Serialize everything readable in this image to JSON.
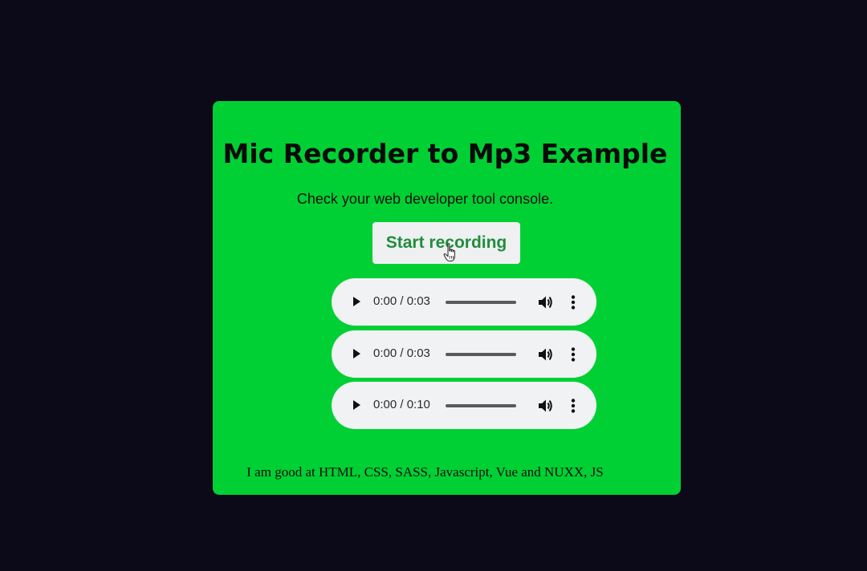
{
  "page": {
    "title": "Mic Recorder to Mp3 Example",
    "subtitle": "Check your web developer tool console.",
    "record_button_label": "Start recording",
    "footer": "I am good at HTML, CSS, SASS, Javascript, Vue and NUXX, JS"
  },
  "players": [
    {
      "time": "0:00 / 0:03",
      "progress": 0
    },
    {
      "time": "0:00 / 0:03",
      "progress": 0
    },
    {
      "time": "0:00 / 0:10",
      "progress": 0
    }
  ],
  "colors": {
    "background": "#0c0a18",
    "card": "#00d034",
    "button_text": "#1f8e3a",
    "player_background": "#f0f2f4"
  },
  "icons": {
    "play": "play-icon",
    "volume": "volume-icon",
    "more": "more-vert-icon",
    "cursor": "hand-pointer-icon"
  }
}
